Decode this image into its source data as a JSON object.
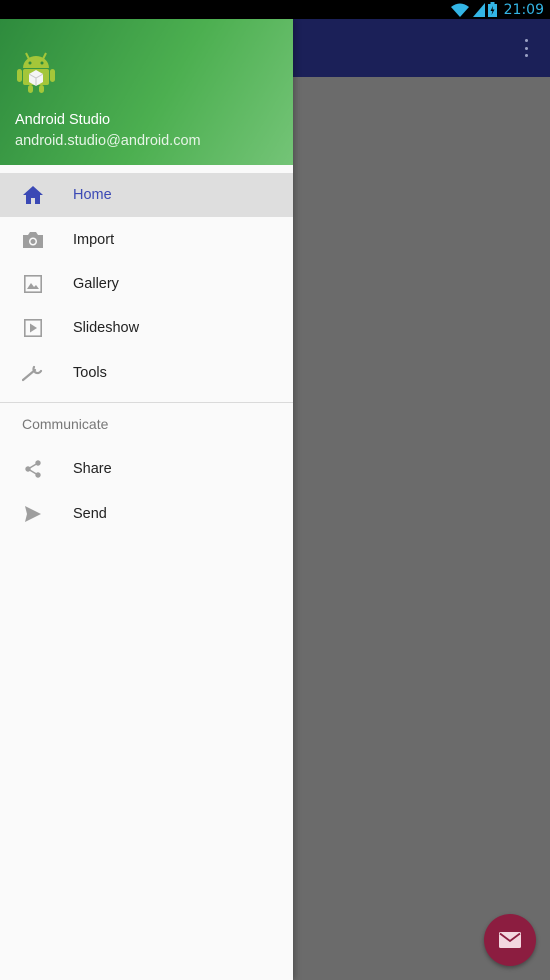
{
  "status_bar": {
    "time": "21:09",
    "icons": [
      "wifi-icon",
      "signal-icon",
      "battery-icon"
    ]
  },
  "colors": {
    "app_bar": "#1b2058",
    "drawer_header_start": "#2e8b3d",
    "drawer_header_end": "#74c477",
    "active_item_text": "#3b49b5",
    "fab": "#8c1d40",
    "status_time": "#33b5e5"
  },
  "drawer": {
    "header": {
      "name": "Android Studio",
      "email": "android.studio@android.com",
      "logo_icon": "android-logo-icon"
    },
    "items": [
      {
        "label": "Home",
        "icon": "home-icon",
        "active": true
      },
      {
        "label": "Import",
        "icon": "camera-icon",
        "active": false
      },
      {
        "label": "Gallery",
        "icon": "image-icon",
        "active": false
      },
      {
        "label": "Slideshow",
        "icon": "slideshow-icon",
        "active": false
      },
      {
        "label": "Tools",
        "icon": "wrench-icon",
        "active": false
      }
    ],
    "section_title": "Communicate",
    "section_items": [
      {
        "label": "Share",
        "icon": "share-icon"
      },
      {
        "label": "Send",
        "icon": "send-icon"
      }
    ]
  },
  "fab": {
    "icon": "email-icon"
  },
  "app_bar": {
    "overflow_icon": "more-vert-icon"
  }
}
